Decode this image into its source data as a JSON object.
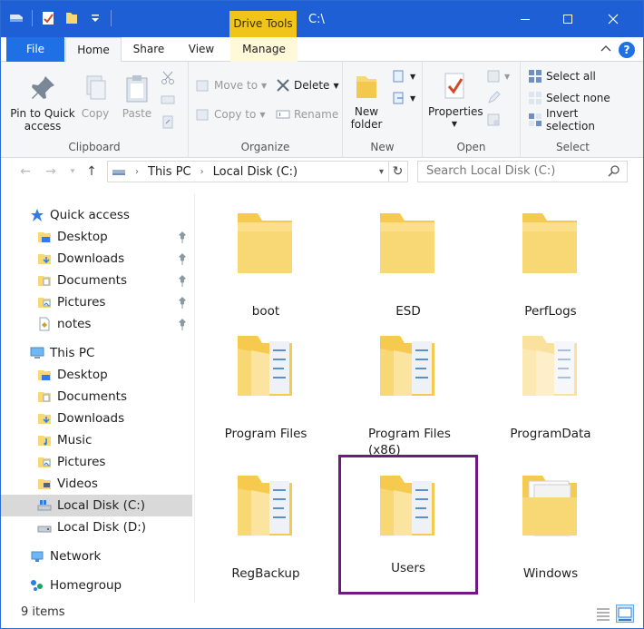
{
  "window": {
    "title": "C:\\",
    "context_tab": "Drive Tools"
  },
  "ribbon": {
    "tabs": [
      "File",
      "Home",
      "Share",
      "View",
      "Manage"
    ],
    "help_label": "?",
    "clipboard": {
      "label": "Clipboard",
      "pin": "Pin to Quick access",
      "pin_l1": "Pin to Quick",
      "pin_l2": "access",
      "copy": "Copy",
      "paste": "Paste"
    },
    "organize": {
      "label": "Organize",
      "move_to": "Move to",
      "copy_to": "Copy to",
      "delete": "Delete",
      "rename": "Rename"
    },
    "new": {
      "label": "New",
      "new_folder_l1": "New",
      "new_folder_l2": "folder"
    },
    "open": {
      "label": "Open",
      "properties": "Properties"
    },
    "select": {
      "label": "Select",
      "select_all": "Select all",
      "select_none": "Select none",
      "invert": "Invert selection"
    }
  },
  "address": {
    "crumbs": [
      "This PC",
      "Local Disk (C:)"
    ],
    "search_placeholder": "Search Local Disk (C:)"
  },
  "sidebar": {
    "quick_access": "Quick access",
    "quick_items": [
      "Desktop",
      "Downloads",
      "Documents",
      "Pictures",
      "notes"
    ],
    "this_pc": "This PC",
    "pc_items": [
      "Desktop",
      "Documents",
      "Downloads",
      "Music",
      "Pictures",
      "Videos",
      "Local Disk (C:)",
      "Local Disk (D:)"
    ],
    "network": "Network",
    "homegroup": "Homegroup"
  },
  "files": [
    {
      "name": "boot",
      "kind": "empty"
    },
    {
      "name": "ESD",
      "kind": "empty"
    },
    {
      "name": "PerfLogs",
      "kind": "empty"
    },
    {
      "name": "Program Files",
      "kind": "full"
    },
    {
      "name": "Program Files (x86)",
      "kind": "full"
    },
    {
      "name": "ProgramData",
      "kind": "full-faded"
    },
    {
      "name": "RegBackup",
      "kind": "full"
    },
    {
      "name": "Users",
      "kind": "full",
      "highlighted": true
    },
    {
      "name": "Windows",
      "kind": "white"
    }
  ],
  "status": {
    "count": "9 items"
  },
  "colors": {
    "titlebar": "#1f5fd6",
    "folder": "#f8d775",
    "highlight": "#6e1a82",
    "drive_tools": "#f0c419"
  }
}
